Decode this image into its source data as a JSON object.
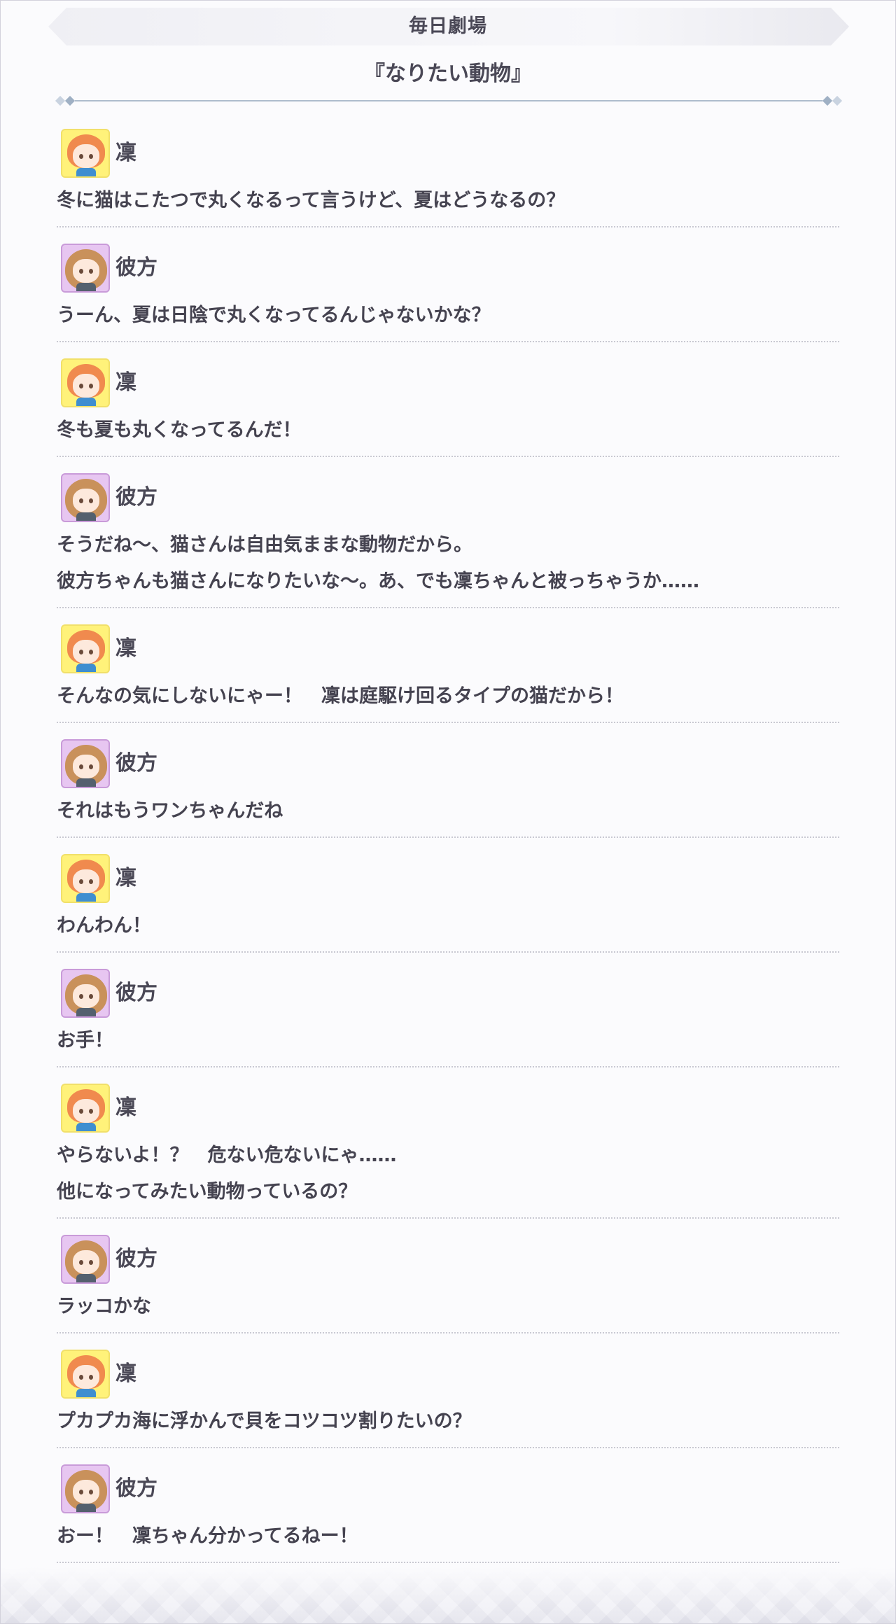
{
  "header": {
    "section_title": "毎日劇場",
    "story_title": "『なりたい動物』"
  },
  "dialogue": [
    {
      "speaker": "凜",
      "avatar": "rin-avatar",
      "lines": [
        "冬に猫はこたつで丸くなるって言うけど、夏はどうなるの？"
      ]
    },
    {
      "speaker": "彼方",
      "avatar": "kanata-avatar",
      "lines": [
        "うーん、夏は日陰で丸くなってるんじゃないかな？"
      ]
    },
    {
      "speaker": "凜",
      "avatar": "rin-avatar",
      "lines": [
        "冬も夏も丸くなってるんだ！"
      ]
    },
    {
      "speaker": "彼方",
      "avatar": "kanata-avatar",
      "lines": [
        "そうだね～、猫さんは自由気ままな動物だから。",
        "彼方ちゃんも猫さんになりたいな～。あ、でも凜ちゃんと被っちゃうか……"
      ]
    },
    {
      "speaker": "凜",
      "avatar": "rin-avatar",
      "lines": [
        "そんなの気にしないにゃー！　凜は庭駆け回るタイプの猫だから！"
      ]
    },
    {
      "speaker": "彼方",
      "avatar": "kanata-avatar",
      "lines": [
        "それはもうワンちゃんだね"
      ]
    },
    {
      "speaker": "凜",
      "avatar": "rin-avatar",
      "lines": [
        "わんわん！"
      ]
    },
    {
      "speaker": "彼方",
      "avatar": "kanata-avatar",
      "lines": [
        "お手！"
      ]
    },
    {
      "speaker": "凜",
      "avatar": "rin-avatar",
      "lines": [
        "やらないよ！？　危ない危ないにゃ……",
        "他になってみたい動物っているの？"
      ]
    },
    {
      "speaker": "彼方",
      "avatar": "kanata-avatar",
      "lines": [
        "ラッコかな"
      ]
    },
    {
      "speaker": "凜",
      "avatar": "rin-avatar",
      "lines": [
        "プカプカ海に浮かんで貝をコツコツ割りたいの？"
      ]
    },
    {
      "speaker": "彼方",
      "avatar": "kanata-avatar",
      "lines": [
        "おー！　凜ちゃん分かってるねー！"
      ]
    }
  ]
}
